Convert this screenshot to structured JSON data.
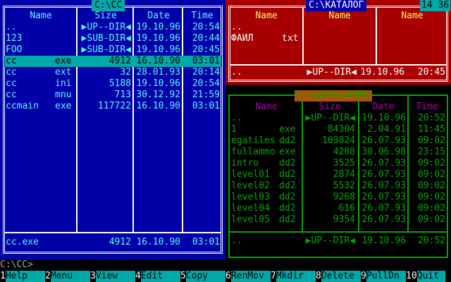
{
  "colors": {
    "left_bg": "#0000a8",
    "left_fg": "#54fcfc",
    "left_frame": "#ffffff",
    "right_top_bg": "#a80000",
    "right_top_fg": "#fcfc54",
    "right_bottom_bg": "#000000",
    "right_bottom_fg": "#00a800",
    "right_bottom_hdr": "#a800a8",
    "selection": "#00a8a8"
  },
  "left_panel": {
    "title": "C:\\CC",
    "headers": [
      "Name",
      "Size",
      "Date",
      "Time"
    ],
    "rows": [
      {
        "name": "..",
        "ext": "",
        "size": "▶UP--DIR◀",
        "date": "19.10.96",
        "time": "20:54"
      },
      {
        "name": "123",
        "ext": "",
        "size": "▶SUB-DIR◀",
        "date": "19.10.96",
        "time": "20:44"
      },
      {
        "name": "FOO",
        "ext": "",
        "size": "▶SUB-DIR◀",
        "date": "19.10.96",
        "time": "20:45"
      },
      {
        "name": "cc",
        "ext": "exe",
        "size": "4912",
        "date": "16.10.90",
        "time": "03:01",
        "selected": true
      },
      {
        "name": "cc",
        "ext": "ext",
        "size": "32",
        "date": "28.01.93",
        "time": "20:14"
      },
      {
        "name": "cc",
        "ext": "ini",
        "size": "5188",
        "date": "19.10.96",
        "time": "20:54"
      },
      {
        "name": "cc",
        "ext": "mnu",
        "size": "713",
        "date": "30.12.92",
        "time": "21:59"
      },
      {
        "name": "ccmain",
        "ext": "exe",
        "size": "117722",
        "date": "16.10.90",
        "time": "03:01"
      }
    ],
    "footer": {
      "name": "cc.exe",
      "size": "4912",
      "date": "16.10.90",
      "time": "03:01"
    }
  },
  "clock": "14 36",
  "right_top_panel": {
    "title": "C:\\КАТАЛОГ",
    "headers": [
      "Name",
      "Name",
      "Name"
    ],
    "rows": [
      {
        "name": "..",
        "ext": ""
      },
      {
        "name": "ФАЙЛ",
        "ext": "txt"
      }
    ],
    "footer": {
      "name": "..",
      "size": "▶UP--DIR◀",
      "date": "19.10.96",
      "time": "20:45"
    }
  },
  "right_bottom_panel": {
    "title": "C:\\GAMES\\AMMO",
    "headers": [
      "Name",
      "Size",
      "Date",
      "Time"
    ],
    "rows": [
      {
        "name": "..",
        "ext": "",
        "size": "▶UP--DIR◀",
        "date": "19.10.96",
        "time": "20:52"
      },
      {
        "name": "1",
        "ext": "exe",
        "size": "84304",
        "date": "2.04.91",
        "time": "11:45"
      },
      {
        "name": "egatiles",
        "ext": "dd2",
        "size": "109824",
        "date": "26.07.93",
        "time": "09:02"
      },
      {
        "name": "fullammo",
        "ext": "exe",
        "size": "4288",
        "date": "30.06.98",
        "time": "23:15"
      },
      {
        "name": "intro",
        "ext": "dd2",
        "size": "3525",
        "date": "26.07.93",
        "time": "09:02"
      },
      {
        "name": "level01",
        "ext": "dd2",
        "size": "2874",
        "date": "26.07.93",
        "time": "09:02"
      },
      {
        "name": "level02",
        "ext": "dd2",
        "size": "5532",
        "date": "26.07.93",
        "time": "09:02"
      },
      {
        "name": "level03",
        "ext": "dd2",
        "size": "9268",
        "date": "26.07.93",
        "time": "09:02"
      },
      {
        "name": "level04",
        "ext": "dd2",
        "size": "616",
        "date": "26.07.93",
        "time": "09:02"
      },
      {
        "name": "level05",
        "ext": "dd2",
        "size": "9354",
        "date": "26.07.93",
        "time": "09:02"
      }
    ],
    "footer": {
      "name": "..",
      "size": "▶UP--DIR◀",
      "date": "19.10.96",
      "time": "20:52"
    }
  },
  "prompt": "C:\\CC>",
  "fkeys": [
    {
      "num": "1",
      "label": "Help"
    },
    {
      "num": "2",
      "label": "Menu"
    },
    {
      "num": "3",
      "label": "View"
    },
    {
      "num": "4",
      "label": "Edit"
    },
    {
      "num": "5",
      "label": "Copy"
    },
    {
      "num": "6",
      "label": "RenMov"
    },
    {
      "num": "7",
      "label": "Mkdir"
    },
    {
      "num": "8",
      "label": "Delete"
    },
    {
      "num": "9",
      "label": "PullDn"
    },
    {
      "num": "10",
      "label": "Quit"
    }
  ]
}
